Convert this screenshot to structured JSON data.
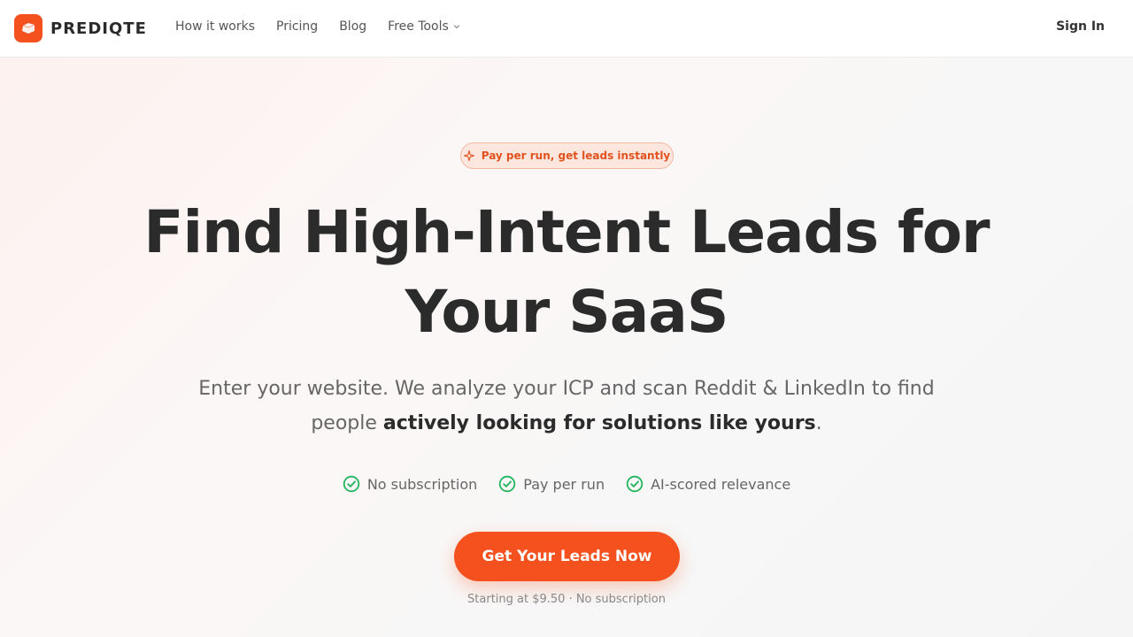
{
  "header": {
    "brand": "PREDIQTE",
    "nav": [
      {
        "label": "How it works"
      },
      {
        "label": "Pricing"
      },
      {
        "label": "Blog"
      },
      {
        "label": "Free Tools",
        "has_dropdown": true
      }
    ],
    "sign_in": "Sign In"
  },
  "hero": {
    "badge": "Pay per run, get leads instantly",
    "title": "Find High-Intent Leads for Your SaaS",
    "subtitle_part1": "Enter your website. We analyze your ICP and scan Reddit & LinkedIn to find people ",
    "subtitle_emphasis": "actively looking for solutions like yours",
    "subtitle_end": ".",
    "features": [
      {
        "label": "No subscription",
        "icon": "check-circle-icon"
      },
      {
        "label": "Pay per run",
        "icon": "check-circle-icon"
      },
      {
        "label": "AI-scored relevance",
        "icon": "check-circle-icon"
      }
    ],
    "cta": "Get Your Leads Now",
    "cta_note": "Starting at $9.50 · No subscription"
  },
  "colors": {
    "accent": "#f4511e",
    "check": "#22b55e",
    "badge_bg": "#fde6de",
    "text_dark": "#2b2b2b"
  }
}
